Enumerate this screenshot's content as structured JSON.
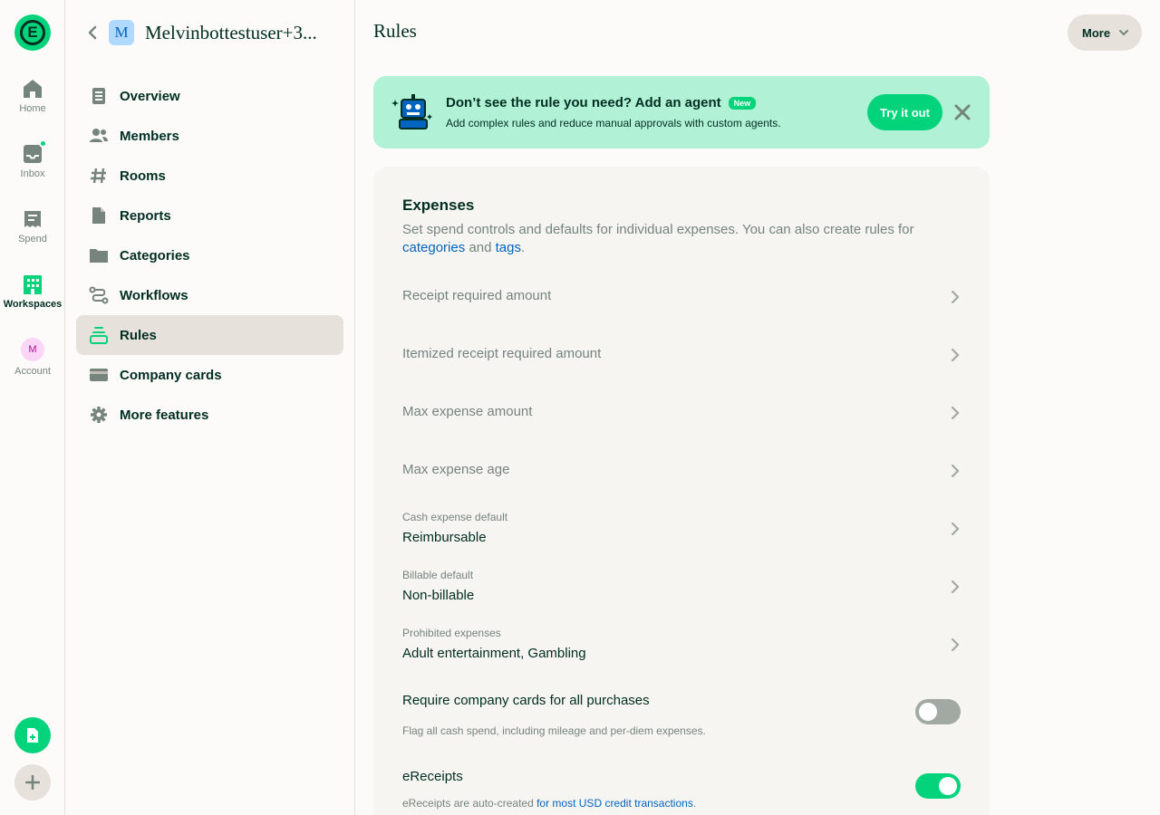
{
  "rail": {
    "logo_letter": "E",
    "items": [
      {
        "label": "Home",
        "icon": "home-icon"
      },
      {
        "label": "Inbox",
        "icon": "inbox-icon"
      },
      {
        "label": "Spend",
        "icon": "receipt-icon"
      },
      {
        "label": "Workspaces",
        "icon": "building-icon"
      },
      {
        "label": "Account",
        "icon": "avatar"
      }
    ],
    "account_initial": "M"
  },
  "workspace": {
    "initial": "M",
    "name": "Melvinbottestuser+3...",
    "menu": [
      {
        "label": "Overview",
        "icon": "document-icon"
      },
      {
        "label": "Members",
        "icon": "users-icon"
      },
      {
        "label": "Rooms",
        "icon": "hashtag-icon"
      },
      {
        "label": "Reports",
        "icon": "file-icon"
      },
      {
        "label": "Categories",
        "icon": "folder-icon"
      },
      {
        "label": "Workflows",
        "icon": "workflow-icon"
      },
      {
        "label": "Rules",
        "icon": "rules-icon"
      },
      {
        "label": "Company cards",
        "icon": "credit-card-icon"
      },
      {
        "label": "More features",
        "icon": "gear-icon"
      }
    ],
    "active_item": "Rules"
  },
  "header": {
    "title": "Rules",
    "more_label": "More"
  },
  "banner": {
    "title": "Don’t see the rule you need? Add an agent",
    "badge": "New",
    "subtitle": "Add complex rules and reduce manual approvals with custom agents.",
    "button": "Try it out"
  },
  "expenses": {
    "title": "Expenses",
    "desc_prefix": "Set spend controls and defaults for individual expenses. You can also create rules for ",
    "link_categories": "categories",
    "and": " and ",
    "link_tags": "tags",
    "period": ".",
    "plain_rows": [
      "Receipt required amount",
      "Itemized receipt required amount",
      "Max expense amount",
      "Max expense age"
    ],
    "value_rows": [
      {
        "label": "Cash expense default",
        "value": "Reimbursable"
      },
      {
        "label": "Billable default",
        "value": "Non-billable"
      },
      {
        "label": "Prohibited expenses",
        "value": "Adult entertainment, Gambling"
      }
    ],
    "toggles": [
      {
        "title": "Require company cards for all purchases",
        "subtitle": "Flag all cash spend, including mileage and per-diem expenses.",
        "on": false
      },
      {
        "title": "eReceipts",
        "subtitle_prefix": "eReceipts are auto-created ",
        "subtitle_link": "for most USD credit transactions",
        "subtitle_suffix": ".",
        "on": true
      }
    ]
  },
  "colors": {
    "accent": "#03d47c",
    "text": "#002e22",
    "muted": "#76847e",
    "link": "#0164bf",
    "banner_bg": "#b1f2d6"
  }
}
